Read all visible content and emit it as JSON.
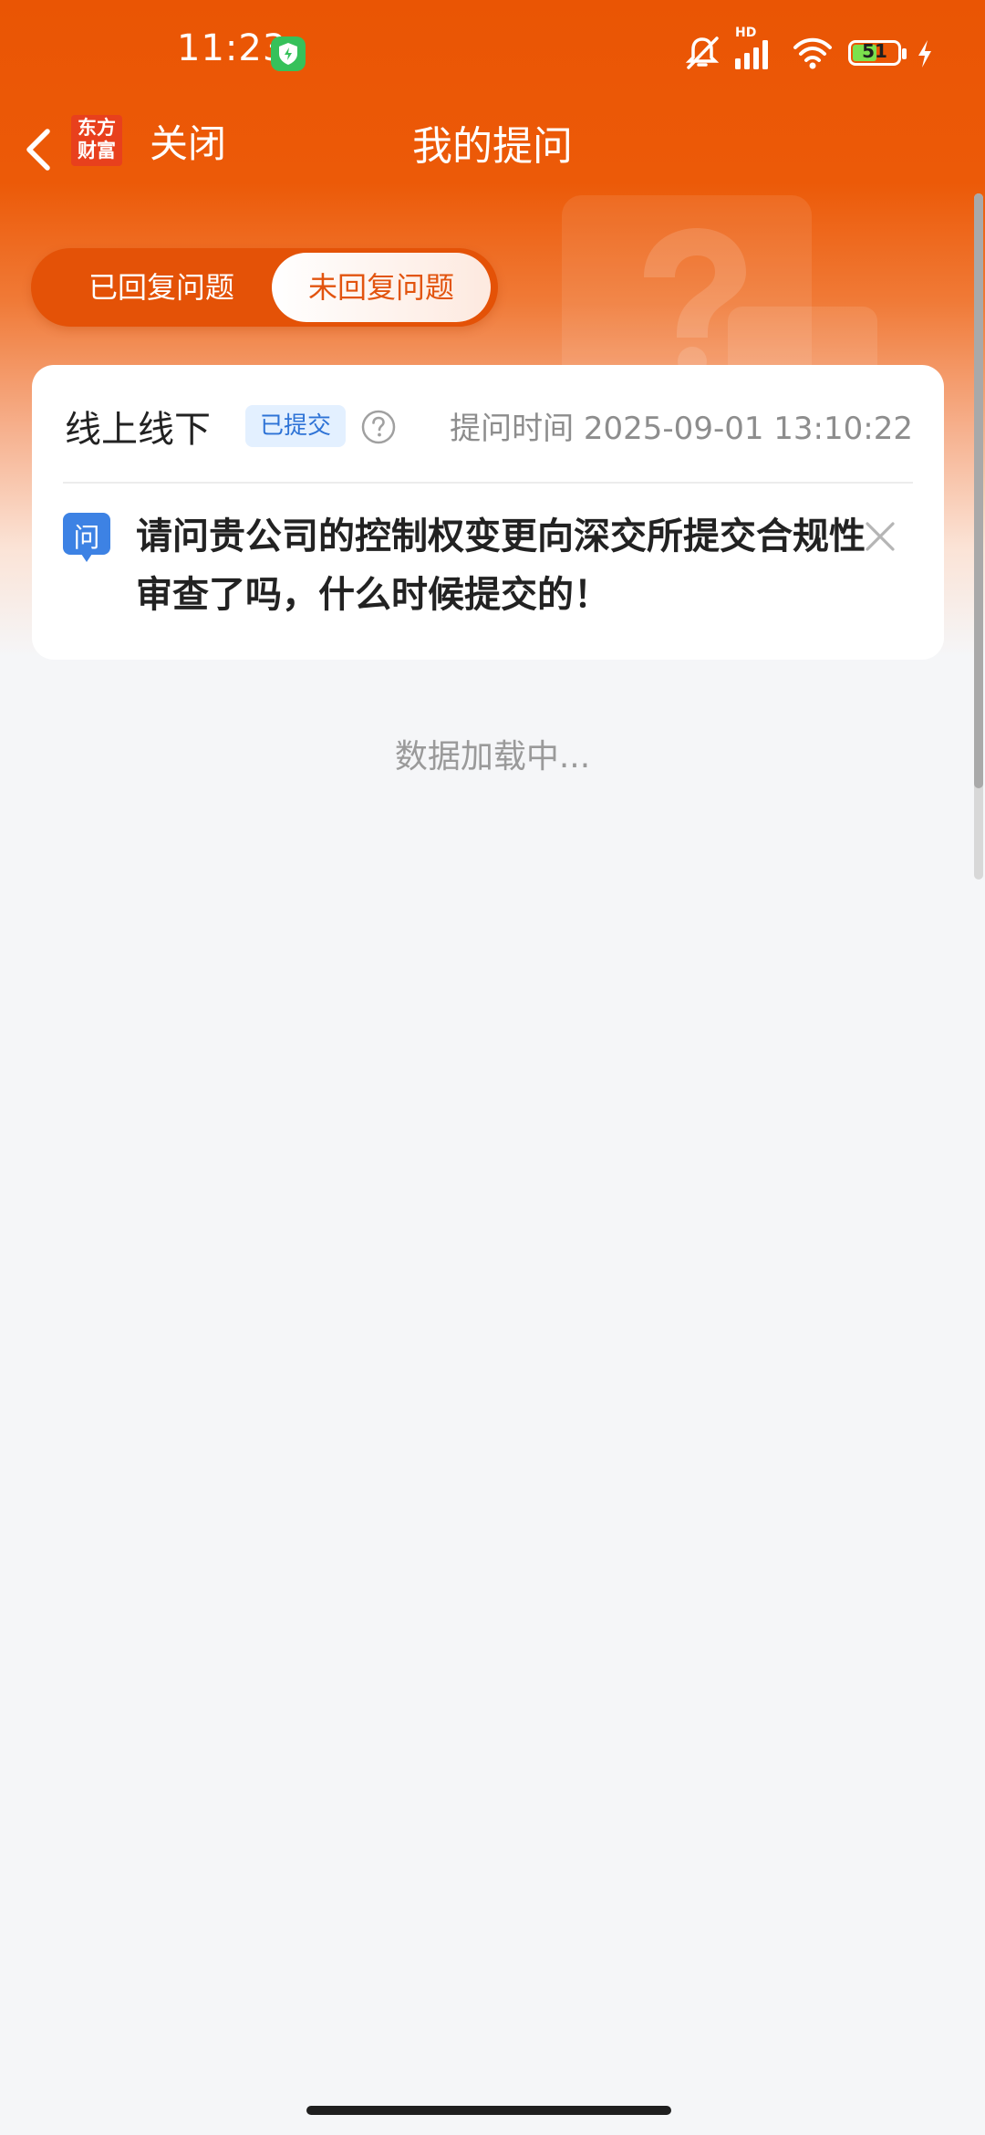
{
  "status_bar": {
    "time": "11:23",
    "battery_level": "51",
    "network_label": "HD",
    "icons": [
      "shield-icon",
      "mute-bell-icon",
      "signal-icon",
      "wifi-icon",
      "battery-icon",
      "charging-icon"
    ]
  },
  "header": {
    "logo_line1": "东方",
    "logo_line2": "财富",
    "close_label": "关闭",
    "title": "我的提问"
  },
  "tabs": [
    {
      "label": "已回复问题",
      "active": false
    },
    {
      "label": "未回复问题",
      "active": true
    }
  ],
  "question_card": {
    "channel": "线上线下",
    "status_badge": "已提交",
    "submit_time": "提问时间 2025-09-01 13:10:22",
    "question_icon_text": "问",
    "question": "请问贵公司的控制权变更向深交所提交合规性审查了吗，什么时候提交的！"
  },
  "loading_text": "数据加载中...",
  "colors": {
    "brand_orange": "#ea5504",
    "badge_blue": "#2e73d6",
    "question_icon_blue": "#3d82e4"
  }
}
